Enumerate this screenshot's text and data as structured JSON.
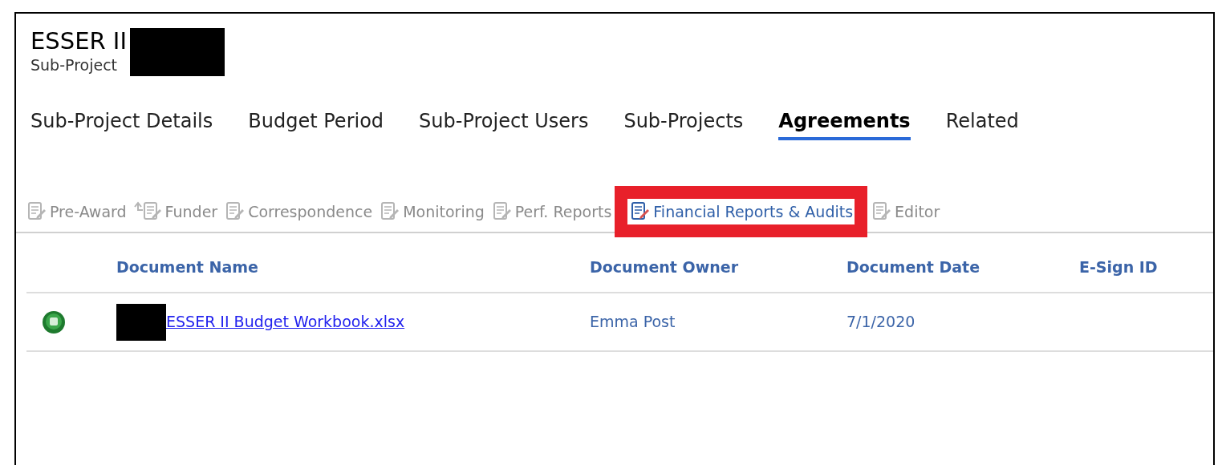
{
  "header": {
    "title": "ESSER II",
    "subtitle": "Sub-Project"
  },
  "tabs": [
    {
      "label": "Sub-Project Details",
      "selected": false
    },
    {
      "label": "Budget Period",
      "selected": false
    },
    {
      "label": "Sub-Project Users",
      "selected": false
    },
    {
      "label": "Sub-Projects",
      "selected": false
    },
    {
      "label": "Agreements",
      "selected": true
    },
    {
      "label": "Related",
      "selected": false
    }
  ],
  "sub_tabs": [
    {
      "label": "Pre-Award",
      "kind": "document",
      "selected": false,
      "highlighted": false
    },
    {
      "label": "Funder",
      "kind": "document-arrow",
      "selected": false,
      "highlighted": false
    },
    {
      "label": "Correspondence",
      "kind": "document",
      "selected": false,
      "highlighted": false
    },
    {
      "label": "Monitoring",
      "kind": "document",
      "selected": false,
      "highlighted": false
    },
    {
      "label": "Perf. Reports",
      "kind": "document",
      "selected": false,
      "highlighted": false
    },
    {
      "label": "Financial Reports & Audits",
      "kind": "document",
      "selected": true,
      "highlighted": true
    },
    {
      "label": "Editor",
      "kind": "document",
      "selected": false,
      "highlighted": false
    }
  ],
  "table": {
    "columns": [
      "Document Name",
      "Document Owner",
      "Document Date",
      "E-Sign ID"
    ],
    "rows": [
      {
        "name": "ESSER II Budget Workbook.xlsx",
        "owner": "Emma Post",
        "date": "7/1/2020"
      }
    ]
  }
}
